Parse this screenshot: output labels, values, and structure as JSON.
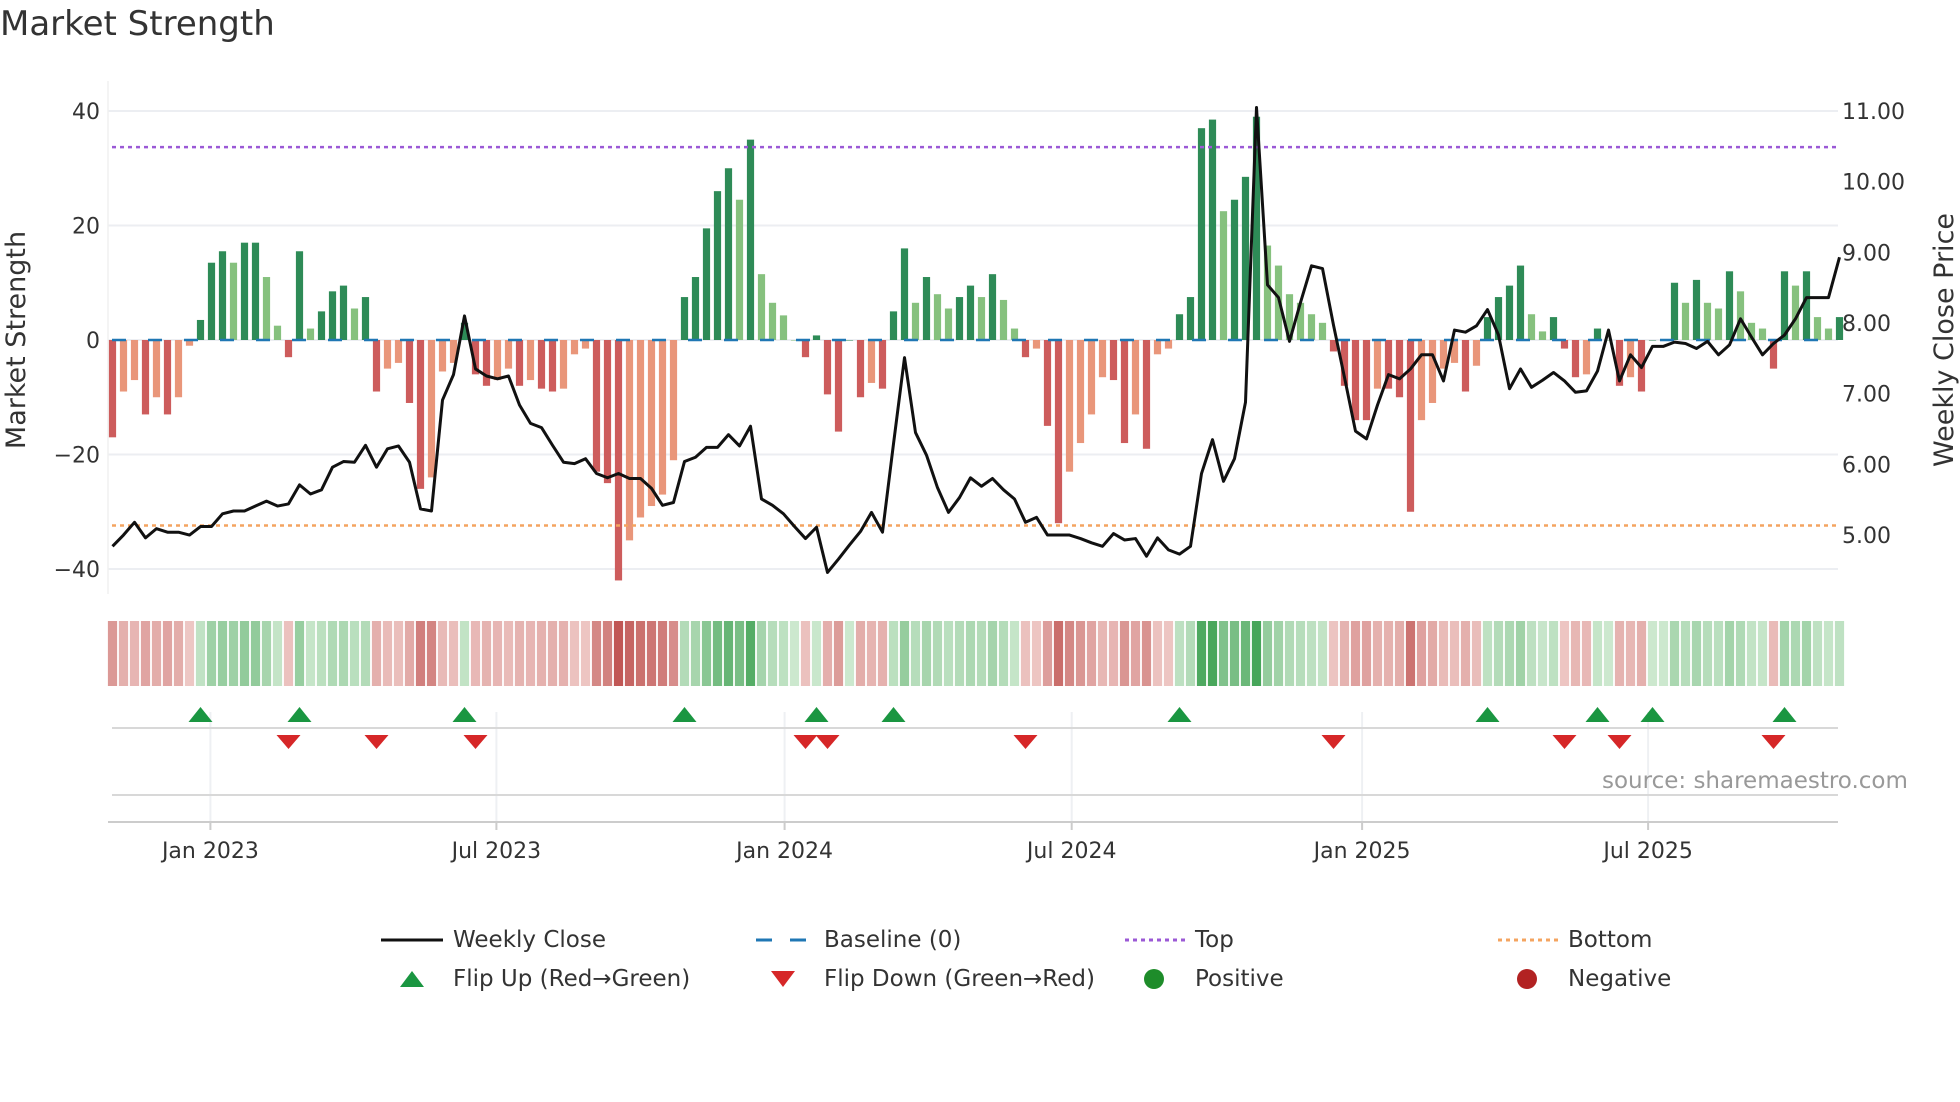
{
  "title": "Market Strength",
  "source": "source: sharemaestro.com",
  "legend": {
    "weekly_close": "Weekly Close",
    "baseline": "Baseline (0)",
    "top": "Top",
    "bottom": "Bottom",
    "flip_up": "Flip Up (Red→Green)",
    "flip_down": "Flip Down (Green→Red)",
    "positive": "Positive",
    "negative": "Negative"
  },
  "colors": {
    "pos_rising": "#2e8b57",
    "pos_falling": "#86c17e",
    "neg_falling": "#cd5c5c",
    "neg_rising": "#e9967a",
    "baseline": "#1f77b4",
    "top": "#9b59d6",
    "bottom": "#f4a460",
    "close": "#111111",
    "flip_up": "#1a9641",
    "flip_down": "#d62728",
    "positive": "#1e8c2a",
    "negative": "#b22222"
  },
  "chart_data": {
    "type": "bar",
    "title": "Market Strength",
    "ylabel": "Market Strength",
    "y2label": "Weekly Close Price",
    "ylim": [
      -45,
      45
    ],
    "y2lim": [
      4.3,
      11.3
    ],
    "y_ticks": [
      "40",
      "20",
      "0",
      "−20",
      "−40"
    ],
    "y_tick_values": [
      40,
      20,
      0,
      -20,
      -40
    ],
    "y2_ticks": [
      "11.00",
      "10.00",
      "9.00",
      "8.00",
      "7.00",
      "6.00",
      "5.00"
    ],
    "y2_tick_values": [
      11,
      10,
      9,
      8,
      7,
      6,
      5
    ],
    "x_ticks": [
      "Jan 2023",
      "Jul 2023",
      "Jan 2024",
      "Jul 2024",
      "Jan 2025",
      "Jul 2025"
    ],
    "x_tick_week_index": [
      8.9,
      34.9,
      61.1,
      87.2,
      113.6,
      139.6
    ],
    "frequency": "weekly",
    "top_level": 33.7,
    "bottom_level": -32.4,
    "baseline": 0,
    "strength": [
      -17,
      -9,
      -7,
      -13,
      -10,
      -13,
      -10,
      -1,
      3.5,
      13.5,
      15.5,
      13.5,
      17,
      17,
      11,
      2.5,
      -3,
      15.5,
      2,
      5,
      8.5,
      9.5,
      5.5,
      7.5,
      -9,
      -5,
      -4,
      -11,
      -26,
      -24,
      -5.5,
      -4,
      3,
      -6,
      -8,
      -7,
      -5,
      -8,
      -7,
      -8.5,
      -9,
      -8.5,
      -2.5,
      -1.5,
      -23,
      -25,
      -42,
      -35,
      -31,
      -29,
      -27,
      -21,
      7.5,
      11,
      19.5,
      26,
      30,
      24.5,
      35,
      11.5,
      6.5,
      4.3,
      0,
      -3,
      0.8,
      -9.5,
      -16,
      0,
      -10,
      -7.5,
      -8.5,
      5,
      16,
      6.5,
      11,
      8,
      5.5,
      7.5,
      9.5,
      7.5,
      11.5,
      7,
      2,
      -3,
      -1.5,
      -15,
      -32,
      -23,
      -18,
      -13,
      -6.5,
      -7,
      -18,
      -13,
      -19,
      -2.5,
      -1.5,
      4.5,
      7.5,
      37,
      38.5,
      22.5,
      24.5,
      28.5,
      39,
      16.5,
      13,
      8,
      6.5,
      4.5,
      3,
      -2,
      -8,
      -14,
      -14,
      -8.5,
      -8.5,
      -10,
      -30,
      -14,
      -11,
      -5,
      -4,
      -9,
      -4.5,
      4,
      7.5,
      9.5,
      13,
      4.5,
      1.5,
      4,
      -1.5,
      -6.5,
      -6,
      2,
      0,
      -8,
      -6.5,
      -9,
      0,
      0,
      10,
      6.5,
      10.5,
      6.5,
      5.5,
      12,
      8.5,
      3,
      2,
      -5,
      12,
      9.5,
      12,
      4,
      2,
      4
    ],
    "weekly_close": [
      4.84,
      5.0,
      5.18,
      4.96,
      5.09,
      5.04,
      5.04,
      5.0,
      5.12,
      5.12,
      5.3,
      5.34,
      5.34,
      5.41,
      5.48,
      5.41,
      5.44,
      5.71,
      5.58,
      5.64,
      5.96,
      6.04,
      6.03,
      6.27,
      5.96,
      6.22,
      6.26,
      6.03,
      5.37,
      5.34,
      6.91,
      7.27,
      8.1,
      7.35,
      7.25,
      7.21,
      7.25,
      6.84,
      6.58,
      6.52,
      6.27,
      6.03,
      6.01,
      6.08,
      5.87,
      5.81,
      5.87,
      5.8,
      5.8,
      5.66,
      5.42,
      5.46,
      6.04,
      6.1,
      6.24,
      6.24,
      6.42,
      6.26,
      6.54,
      5.51,
      5.42,
      5.3,
      5.12,
      4.95,
      5.11,
      4.47,
      4.66,
      4.86,
      5.05,
      5.32,
      5.04,
      6.29,
      7.51,
      6.45,
      6.13,
      5.67,
      5.32,
      5.53,
      5.81,
      5.69,
      5.8,
      5.64,
      5.51,
      5.18,
      5.25,
      5.0,
      5.0,
      5.0,
      4.95,
      4.89,
      4.84,
      5.02,
      4.93,
      4.95,
      4.7,
      4.96,
      4.79,
      4.73,
      4.84,
      5.87,
      6.35,
      5.76,
      6.08,
      6.88,
      11.05,
      8.54,
      8.36,
      7.74,
      8.29,
      8.81,
      8.77,
      7.97,
      7.23,
      6.47,
      6.36,
      6.84,
      7.27,
      7.21,
      7.35,
      7.55,
      7.55,
      7.18,
      7.9,
      7.87,
      7.96,
      8.19,
      7.83,
      7.07,
      7.35,
      7.09,
      7.19,
      7.3,
      7.18,
      7.02,
      7.04,
      7.32,
      7.9,
      7.18,
      7.55,
      7.37,
      7.67,
      7.67,
      7.73,
      7.71,
      7.64,
      7.74,
      7.55,
      7.69,
      8.06,
      7.8,
      7.55,
      7.71,
      7.83,
      8.06,
      8.36,
      8.36,
      8.36,
      8.93
    ],
    "flip_up_weeks": [
      8,
      17,
      32,
      52,
      64,
      71,
      97,
      125,
      135,
      140,
      152
    ],
    "flip_down_weeks": [
      16,
      24,
      33,
      63,
      65,
      83,
      111,
      132,
      137,
      151
    ]
  }
}
